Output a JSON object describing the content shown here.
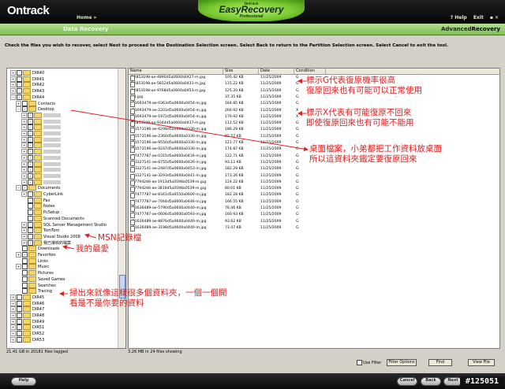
{
  "header": {
    "brand": "Ontrack",
    "home_link": "Home »",
    "logo_small": "Ontrack",
    "logo_main": "EasyRecovery",
    "logo_sub": "Professional",
    "help_link": "? Help",
    "exit_link": "Exit",
    "window_controls": "▪ ✕"
  },
  "subbar": {
    "section": "Data Recovery",
    "mode_prefix": "Advanced",
    "mode_bold": "Recovery"
  },
  "instruction": "Check the files you wish to recover, select Next to proceed to the Destination Selection screen. Select Back to return to the Partition Selection screen. Select Cancel to exit the tool.",
  "tree": [
    {
      "label": "DIR40",
      "ex": "+",
      "cb": false,
      "folder": true,
      "indent": 1
    },
    {
      "label": "DIR41",
      "ex": "+",
      "cb": false,
      "folder": true,
      "indent": 1
    },
    {
      "label": "DIR42",
      "ex": "+",
      "cb": false,
      "folder": true,
      "indent": 1
    },
    {
      "label": "DIR43",
      "ex": "+",
      "cb": false,
      "folder": true,
      "indent": 1
    },
    {
      "label": "DIR44",
      "ex": "−",
      "cb": true,
      "folder": true,
      "indent": 1
    },
    {
      "label": "Contacts",
      "ex": "+",
      "cb": false,
      "folder": true,
      "indent": 2
    },
    {
      "label": "Desktop",
      "ex": "−",
      "cb": true,
      "folder": true,
      "indent": 2
    },
    {
      "label": "",
      "ex": "+",
      "cb": true,
      "folder": true,
      "indent": 3,
      "blur": true
    },
    {
      "label": "",
      "ex": "+",
      "cb": true,
      "folder": true,
      "indent": 3,
      "blur": true
    },
    {
      "label": "",
      "ex": "+",
      "cb": true,
      "folder": true,
      "indent": 3,
      "blur": true
    },
    {
      "label": "",
      "ex": "+",
      "cb": true,
      "folder": true,
      "indent": 3,
      "blur": true
    },
    {
      "label": "",
      "ex": "+",
      "cb": true,
      "folder": true,
      "indent": 3,
      "blur": true
    },
    {
      "label": "",
      "ex": "+",
      "cb": true,
      "folder": true,
      "indent": 3,
      "blur": true
    },
    {
      "label": "",
      "ex": "+",
      "cb": true,
      "folder": true,
      "indent": 3,
      "blur": true
    },
    {
      "label": "",
      "ex": "+",
      "cb": true,
      "folder": true,
      "indent": 3,
      "blur": true
    },
    {
      "label": "",
      "ex": "+",
      "cb": true,
      "folder": true,
      "indent": 3,
      "blur": true
    },
    {
      "label": "",
      "ex": "+",
      "cb": true,
      "folder": true,
      "indent": 3,
      "blur": true
    },
    {
      "label": "",
      "ex": "+",
      "cb": true,
      "folder": true,
      "indent": 3,
      "blur": true
    },
    {
      "label": "",
      "ex": "+",
      "cb": true,
      "folder": true,
      "indent": 3,
      "blur": true
    },
    {
      "label": "Documents",
      "ex": "−",
      "cb": true,
      "folder": true,
      "indent": 2
    },
    {
      "label": "CyberLink",
      "ex": "+",
      "cb": false,
      "folder": true,
      "indent": 3
    },
    {
      "label": "Fax",
      "ex": "",
      "cb": false,
      "folder": true,
      "indent": 3
    },
    {
      "label": "Notes",
      "ex": "",
      "cb": false,
      "folder": true,
      "indent": 3
    },
    {
      "label": "PcSetup",
      "ex": "",
      "cb": false,
      "folder": true,
      "indent": 3
    },
    {
      "label": "Scanned Documents",
      "ex": "",
      "cb": false,
      "folder": true,
      "indent": 3
    },
    {
      "label": "SQL Server Management Studio",
      "ex": "+",
      "cb": false,
      "folder": true,
      "indent": 3
    },
    {
      "label": "TomTom",
      "ex": "+",
      "cb": false,
      "folder": true,
      "indent": 3
    },
    {
      "label": "Visual Studio 2008",
      "ex": "+",
      "cb": false,
      "folder": true,
      "indent": 3
    },
    {
      "label": "我已接收的檔案",
      "ex": "+",
      "cb": true,
      "folder": true,
      "indent": 3
    },
    {
      "label": "Downloads",
      "ex": "",
      "cb": false,
      "folder": true,
      "indent": 2
    },
    {
      "label": "Favorites",
      "ex": "+",
      "cb": true,
      "folder": true,
      "indent": 2
    },
    {
      "label": "Links",
      "ex": "",
      "cb": false,
      "folder": true,
      "indent": 2
    },
    {
      "label": "Music",
      "ex": "+",
      "cb": false,
      "folder": true,
      "indent": 2
    },
    {
      "label": "Pictures",
      "ex": "",
      "cb": false,
      "folder": true,
      "indent": 2
    },
    {
      "label": "Saved Games",
      "ex": "",
      "cb": false,
      "folder": true,
      "indent": 2
    },
    {
      "label": "Searches",
      "ex": "",
      "cb": false,
      "folder": true,
      "indent": 2
    },
    {
      "label": "Tracing",
      "ex": "",
      "cb": false,
      "folder": true,
      "indent": 2
    },
    {
      "label": "DIR45",
      "ex": "+",
      "cb": false,
      "folder": true,
      "indent": 1
    },
    {
      "label": "DIR46",
      "ex": "+",
      "cb": false,
      "folder": true,
      "indent": 1
    },
    {
      "label": "DIR47",
      "ex": "+",
      "cb": false,
      "folder": true,
      "indent": 1
    },
    {
      "label": "DIR48",
      "ex": "+",
      "cb": false,
      "folder": true,
      "indent": 1
    },
    {
      "label": "DIR49",
      "ex": "+",
      "cb": false,
      "folder": true,
      "indent": 1
    },
    {
      "label": "DIR51",
      "ex": "+",
      "cb": false,
      "folder": true,
      "indent": 1
    },
    {
      "label": "DIR52",
      "ex": "+",
      "cb": false,
      "folder": true,
      "indent": 1
    },
    {
      "label": "DIR53",
      "ex": "+",
      "cb": false,
      "folder": true,
      "indent": 1
    }
  ],
  "columns": [
    "Name",
    "Size",
    "Date",
    "Condition"
  ],
  "files": [
    {
      "name": "f12853198-ae-4890d5a0600a0427-m.jpg",
      "size": "105.42 KB",
      "date": "11/25/2009",
      "cond": "G"
    },
    {
      "name": "f12853198-ae-5812d5a0600a0431-m.jpg",
      "size": "115.22 KB",
      "date": "11/25/2009",
      "cond": "G"
    },
    {
      "name": "f12853198-ae-9768d5a0600a0453-m.jpg",
      "size": "125.20 KB",
      "date": "11/25/2009",
      "cond": "G"
    },
    {
      "name": "4-8.jpg",
      "size": "37.35 KB",
      "date": "11/25/2009",
      "cond": "G"
    },
    {
      "name": "b51693479-ae-0363d5a0600a0454-m.jpg",
      "size": "184.85 KB",
      "date": "11/25/2009",
      "cond": "G"
    },
    {
      "name": "b51693479-ae-2203d5a0600a0454-m.jpg",
      "size": "266.92 KB",
      "date": "11/25/2009",
      "cond": "X"
    },
    {
      "name": "b51693479-ae-1972d5a0600a0454-m.jpg",
      "size": "176.92 KB",
      "date": "11/25/2009",
      "cond": "X"
    },
    {
      "name": "f12853198-ae-9344d5a0600a0437-m.jpg",
      "size": "112.52 KB",
      "date": "11/25/2009",
      "cond": "G"
    },
    {
      "name": "b51573196-ae-6298d5a0600a0330-m.jpg",
      "size": "186.29 KB",
      "date": "11/25/2009",
      "cond": "G"
    },
    {
      "name": "b51573196-ae-2360d5a0600a0330-m.jpg",
      "size": "82.57 KB",
      "date": "11/25/2009",
      "cond": "G"
    },
    {
      "name": "b51573196-ae-9550d5a0600a0330-m.jpg",
      "size": "121.77 KB",
      "date": "11/25/2009",
      "cond": "G"
    },
    {
      "name": "b51573196-ae-0247d5a0600a0330-m.jpg",
      "size": "174.87 KB",
      "date": "11/25/2009",
      "cond": "G"
    },
    {
      "name": "e37477787-ae-0315d5a0600a0416-m.jpg",
      "size": "122.71 KB",
      "date": "11/25/2009",
      "cond": "G"
    },
    {
      "name": "d43327141-ae-6755d5a0600a0426-m.jpg",
      "size": "93.12 KB",
      "date": "11/25/2009",
      "cond": "G"
    },
    {
      "name": "d43327141-ae-2487d5a0600a0453-m.jpg",
      "size": "182.29 KB",
      "date": "11/25/2009",
      "cond": "G"
    },
    {
      "name": "d43327141-ae-3293d5a0600a0441-m.jpg",
      "size": "173.26 KB",
      "date": "11/25/2009",
      "cond": "G"
    },
    {
      "name": "c47794246-ae-1913d5a0598a0539-m.jpg",
      "size": "124.22 KB",
      "date": "11/25/2009",
      "cond": "G"
    },
    {
      "name": "c47794246-ae-3816d5a0598a0539-m.jpg",
      "size": "80.01 KB",
      "date": "11/25/2009",
      "cond": "G"
    },
    {
      "name": "e37477787-ae-8341d5a0550a0600-m.jpg",
      "size": "182.28 KB",
      "date": "11/25/2009",
      "cond": "G"
    },
    {
      "name": "e37477787-ae-7044d5a0600a0446-m.jpg",
      "size": "166.55 KB",
      "date": "11/25/2009",
      "cond": "G"
    },
    {
      "name": "b51636489-ae-5790d5a0600a0440-m.jpg",
      "size": "76.46 KB",
      "date": "11/25/2009",
      "cond": "G"
    },
    {
      "name": "e37477787-ae-0606d5a0600a0593-m.jpg",
      "size": "160.93 KB",
      "date": "11/25/2009",
      "cond": "G"
    },
    {
      "name": "b51636489-ae-8876d5a0600a0440-m.jpg",
      "size": "93.62 KB",
      "date": "11/25/2009",
      "cond": "G"
    },
    {
      "name": "b51636489-ae-3198d5a0600a0440-m.jpg",
      "size": "73.47 KB",
      "date": "11/25/2009",
      "cond": "G"
    }
  ],
  "status": {
    "left": "21.41 GB in 20181 files tagged",
    "right": "3.26 MB in 24 files showing"
  },
  "controls": {
    "use_filter": "Use Filter",
    "filter_options": "Filter Options",
    "find": "Find",
    "view_file": "View File"
  },
  "nav": {
    "help": "Help",
    "exit": "Exit",
    "cancel": "Cancel",
    "back": "Back",
    "next": "Next"
  },
  "annotations": {
    "g_line1": "標示G代表復原機率很高",
    "g_line2": "復原回來也有可能可以正常使用",
    "x_line1": "標示X代表有可能復原不回來",
    "x_line2": "即使復原回來也有可能不能用",
    "desk_line1": "桌面檔案，小弟都把工作資料放桌面",
    "desk_line2": "所以這資料夾鐵定要復原回來",
    "msn": "MSN記錄檔",
    "fav": "我的最愛",
    "scan_line1": "掃出來就像這樣很多個資料夾，一個一個開",
    "scan_line2": "看是不是你要的資料"
  },
  "watermark": "#125051",
  "colors": {
    "accent_green": "#7ccb31",
    "annotation_red": "#e02020"
  }
}
